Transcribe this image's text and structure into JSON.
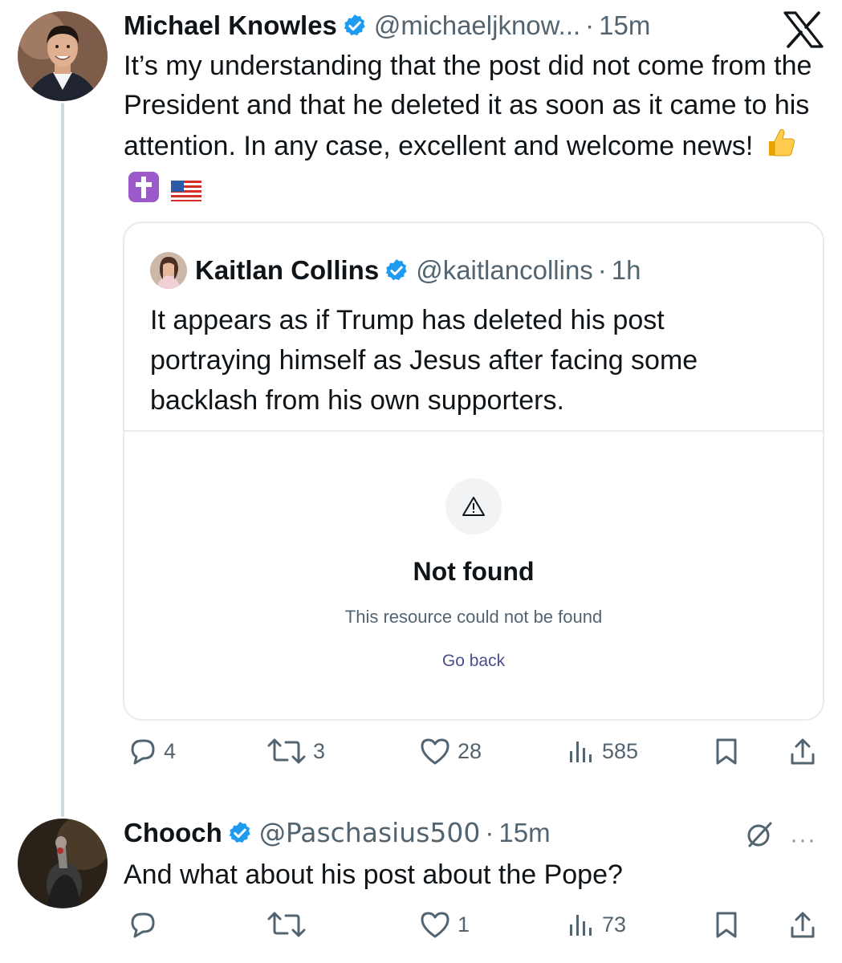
{
  "tweet1": {
    "name": "Michael Knowles",
    "handle": "@michaeljknow...",
    "separator": "·",
    "time": "15m",
    "text": "It’s my understanding that the post did not come from the President and that he deleted it as soon as it came to his attention. In any case, excellent and welcome news!",
    "emojis": [
      "thumbs-up",
      "latin-cross",
      "us-flag"
    ],
    "quote": {
      "name": "Kaitlan Collins",
      "handle": "@kaitlancollins",
      "separator": "·",
      "time": "1h",
      "text": "It appears as if Trump has deleted his post portraying himself as Jesus after facing some backlash from his own supporters.",
      "not_found": {
        "title": "Not found",
        "subtitle": "This resource could not be found",
        "back_label": "Go back"
      }
    },
    "stats": {
      "replies": "4",
      "reposts": "3",
      "likes": "28",
      "views": "585"
    }
  },
  "tweet2": {
    "name": "Chooch",
    "handle": "@Paschasius500",
    "separator": "·",
    "time": "15m",
    "text": "And what about his post about the Pope?",
    "stats": {
      "replies": "",
      "reposts": "",
      "likes": "1",
      "views": "73"
    },
    "more_label": "···"
  },
  "colors": {
    "verified": "#1d9bf0",
    "secondary_text": "#536471",
    "thread_line": "#cfd9de",
    "border": "#e7ecf0"
  }
}
